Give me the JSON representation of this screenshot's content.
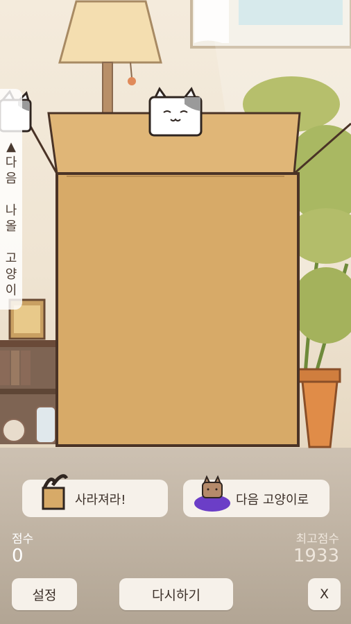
{
  "next_panel": {
    "label_chars": [
      "▲",
      "다",
      "음",
      "",
      "나",
      "올",
      "",
      "고",
      "양",
      "이"
    ]
  },
  "skills": {
    "disappear_label": "사라져라!",
    "next_cat_label": "다음 고양이로"
  },
  "score": {
    "label": "점수",
    "value": "0"
  },
  "best_score": {
    "label": "최고점수",
    "value": "1933"
  },
  "buttons": {
    "settings_label": "설정",
    "restart_label": "다시하기",
    "close_label": "X"
  },
  "colors": {
    "box": "#d9ad6b",
    "box_outline": "#4a3326",
    "cat_white": "#ffffff",
    "floor": "#bcae9d",
    "button_bg": "#f6f1ea"
  }
}
